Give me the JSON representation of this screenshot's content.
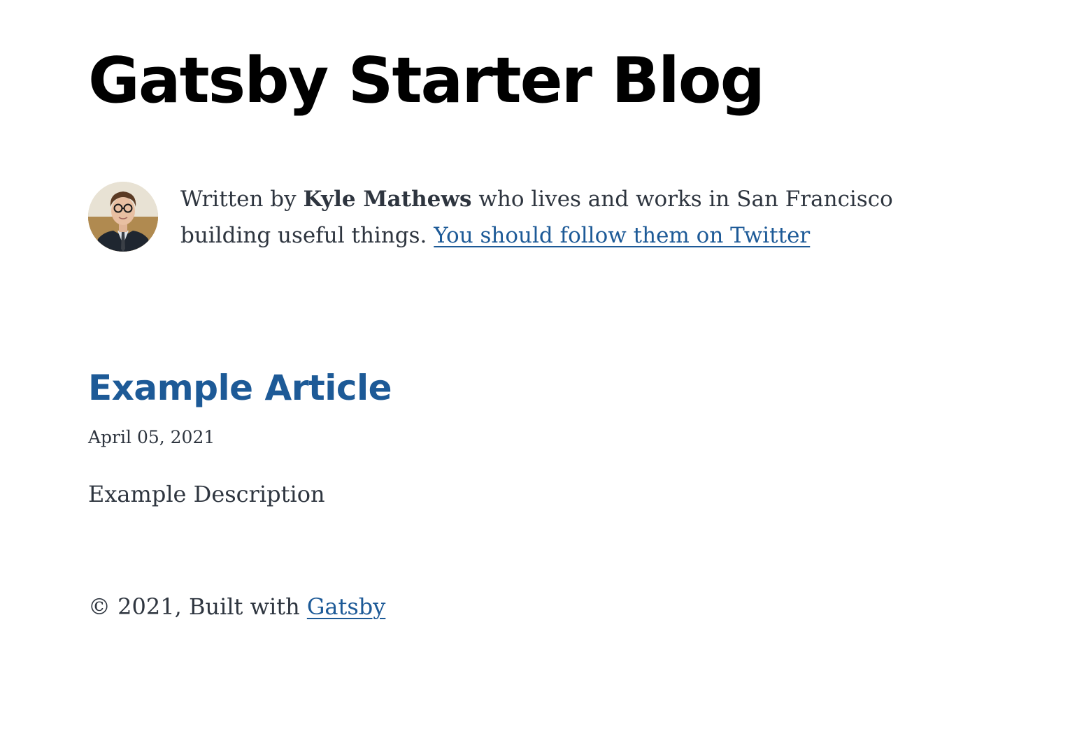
{
  "header": {
    "title": "Gatsby Starter Blog"
  },
  "bio": {
    "prefix": "Written by ",
    "author": "Kyle Mathews",
    "middle": " who lives and works in San Francisco building useful things. ",
    "twitter_link": "You should follow them on Twitter",
    "avatar_icon": "profile-photo"
  },
  "posts": [
    {
      "title": "Example Article",
      "date": "April 05, 2021",
      "description": "Example Description"
    }
  ],
  "footer": {
    "prefix": "© 2021, Built with ",
    "link": "Gatsby"
  },
  "colors": {
    "link": "#1d5a97",
    "text": "#2e353f",
    "heading": "#000000"
  }
}
